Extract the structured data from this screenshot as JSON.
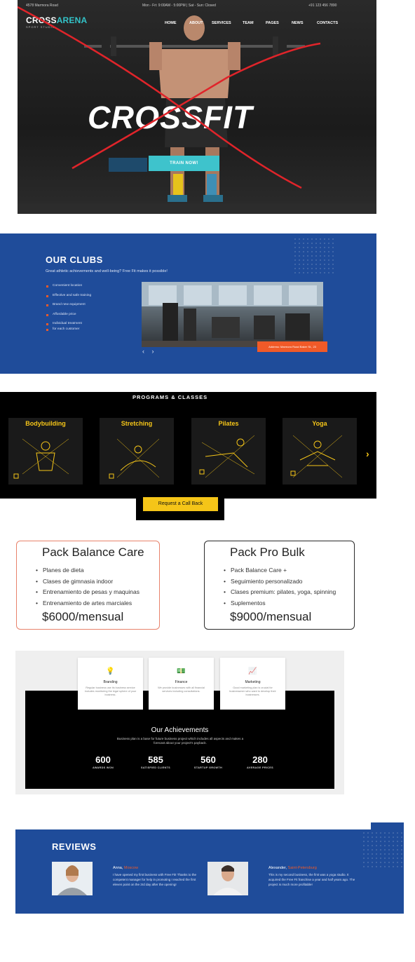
{
  "hero": {
    "address": "4578 Marmora Road",
    "hours": "Mon - Fri: 9:00AM - 5:00PM | Sat - Sun: Closed",
    "phone": "+91 123 456 7890",
    "logo_a": "CROSS",
    "logo_b": "ARENA",
    "logo_sub": "SPORT STUDIO",
    "nav": [
      "HOME",
      "ABOUT",
      "SERVICES",
      "TEAM",
      "PAGES",
      "NEWS",
      "CONTACTS"
    ],
    "title": "CROSSFIT",
    "button": "TRAIN NOW!",
    "cross_color": "#e0242a",
    "accent": "#3ec3cc"
  },
  "clubs": {
    "title": "OUR CLUBS",
    "subtitle": "Great athletic achievements and well-being? Free Fit makes it possible!",
    "features": [
      "Convenient location",
      "Effective and safe training",
      "Brand new equipment",
      "Affordable price",
      "Individual treatment",
      "for each customer"
    ],
    "tag": "Address: Marmora Road Baker St., 23",
    "prev": "‹",
    "next": "›",
    "background": "#1f4c9a"
  },
  "programs": {
    "title": "PROGRAMS & CLASSES",
    "cards": [
      "Bodybuilding",
      "Stretching",
      "Pilates",
      "Yoga"
    ],
    "next": "›",
    "callback": "Request a Call Back",
    "accent": "#f5c518"
  },
  "packs": [
    {
      "title": "Pack Balance Care",
      "items": [
        "Planes de dieta",
        "Clases de gimnasia indoor",
        "Entrenamiento de pesas y maquinas",
        "Entrenamiento de artes marciales"
      ],
      "price": "$6000/mensual",
      "border": "#e8826b"
    },
    {
      "title": "Pack Pro Bulk",
      "items": [
        "Pack Balance Care +",
        "Seguimiento personalizado",
        "Clases premium: pilates, yoga, spinning",
        "Suplementos"
      ],
      "price": "$9000/mensual",
      "border": "#2a2a2a"
    }
  ],
  "services": [
    {
      "icon": "lightbulb-icon",
      "glyph": "💡",
      "title": "Branding",
      "desc": "Regular business use its business service includes monitoring the legal sphere of your business."
    },
    {
      "icon": "money-icon",
      "glyph": "💵",
      "title": "Finance",
      "desc": "We provide businesses with all financial services including consultations."
    },
    {
      "icon": "chart-icon",
      "glyph": "📈",
      "title": "Marketing",
      "desc": "Good marketing plan is crucial for businessmen who want to develop their businesses."
    }
  ],
  "achievements": {
    "title": "Our Achievements",
    "subtitle": "Business plan is a base for future business project which includes all aspects and makes a forecast about your project's payback.",
    "stats": [
      {
        "value": "600",
        "label": "AWARDS WON"
      },
      {
        "value": "585",
        "label": "SATISFIED CLIENTS"
      },
      {
        "value": "560",
        "label": "STARTUP GROWTH"
      },
      {
        "value": "280",
        "label": "AVERAGE PRICES"
      }
    ]
  },
  "reviews": {
    "title": "REVIEWS",
    "items": [
      {
        "name": "Anna, ",
        "city": "Moscow",
        "text": "I have opened my first business with Free Fit! Thanks to the competent manager for help in promoting I reached the first eleven point on the 3rd day after the opening!"
      },
      {
        "name": "Alexander, ",
        "city": "Saint-Petersburg",
        "text": "This is my second business, the first was a yoga studio. It acquired the Free Fit franchise a year and half years ago. The project is much more profitable!"
      }
    ]
  }
}
